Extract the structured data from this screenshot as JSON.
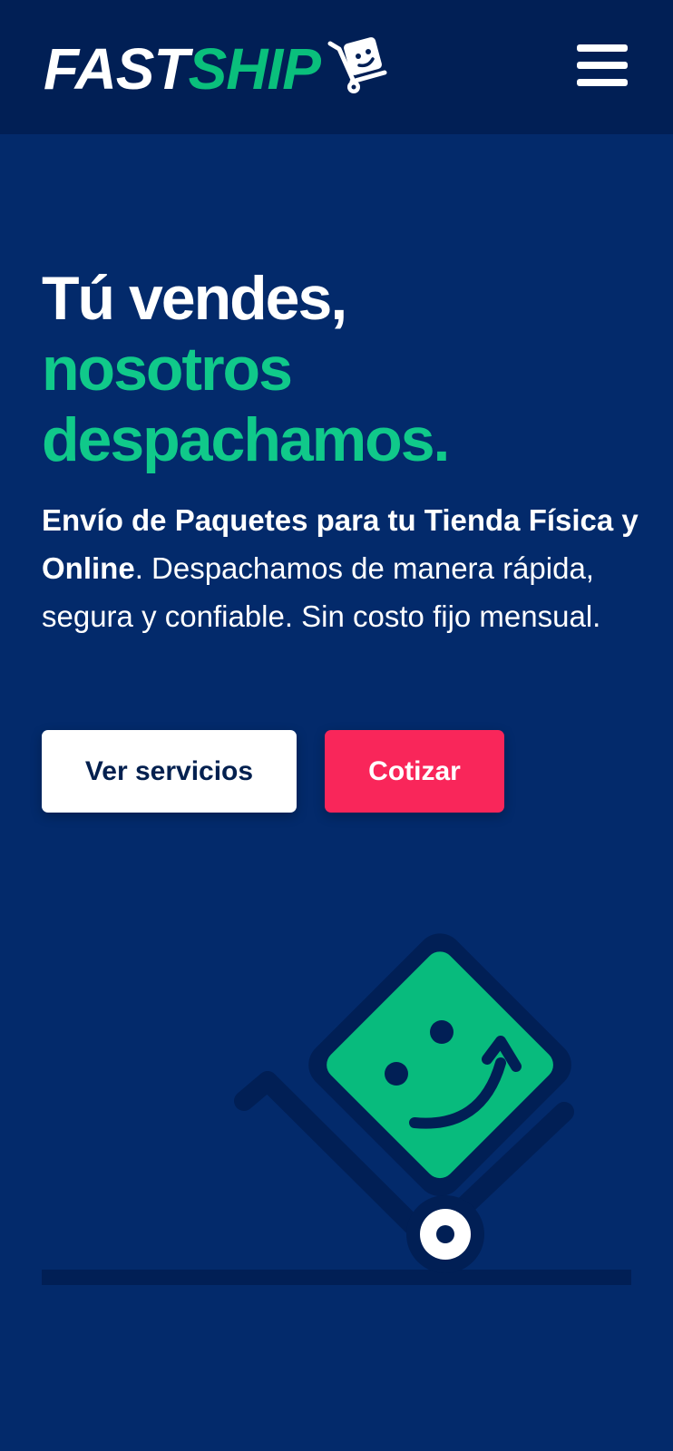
{
  "header": {
    "logo_part1": "FAST",
    "logo_part2": "SHIP",
    "logo_icon": "smiley-box-cart-icon",
    "menu_icon": "hamburger-menu-icon"
  },
  "hero": {
    "title_line1": "Tú vendes,",
    "title_line2a": "nosotros",
    "title_line2b": "despachamos.",
    "description_bold": "Envío de Paquetes para tu Tienda Física y Online",
    "description_rest": ". Despachamos de manera rápida, segura y confiable. Sin costo fijo mensual.",
    "button_services": "Ver servicios",
    "button_quote": "Cotizar"
  },
  "illustration": {
    "name": "smiley-package-hand-truck",
    "icon": "smiley-box-cart-icon"
  },
  "colors": {
    "page_background": "#032a6b",
    "header_background": "#011f55",
    "accent_green": "#10c98a",
    "accent_pink": "#f9265a",
    "dark_navy": "#03204f",
    "white": "#ffffff"
  }
}
